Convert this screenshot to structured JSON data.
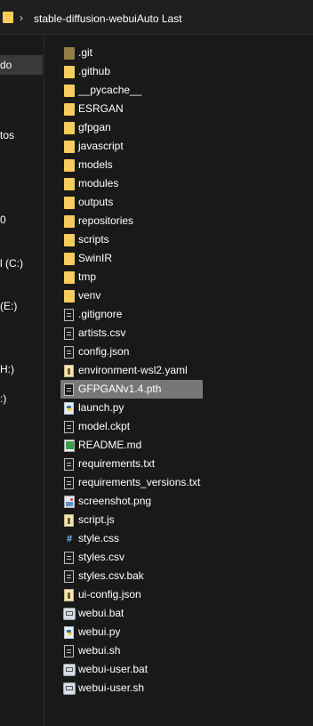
{
  "address_bar": {
    "separator": "›",
    "path": "stable-diffusion-webuiAuto Last"
  },
  "nav_pane": {
    "items": [
      {
        "label": "do",
        "selected": true
      },
      {
        "label": "tos",
        "selected": false
      },
      {
        "label": "0",
        "selected": false
      },
      {
        "label": "l (C:)",
        "selected": false
      },
      {
        "label": "(E:)",
        "selected": false
      },
      {
        "label": "H:)",
        "selected": false
      },
      {
        "label": ":)",
        "selected": false
      }
    ]
  },
  "files": [
    {
      "name": ".git",
      "icon": "folder-hidden-icon"
    },
    {
      "name": ".github",
      "icon": "folder-icon"
    },
    {
      "name": "__pycache__",
      "icon": "folder-icon"
    },
    {
      "name": "ESRGAN",
      "icon": "folder-icon"
    },
    {
      "name": "gfpgan",
      "icon": "folder-icon"
    },
    {
      "name": "javascript",
      "icon": "folder-icon"
    },
    {
      "name": "models",
      "icon": "folder-icon"
    },
    {
      "name": "modules",
      "icon": "folder-icon"
    },
    {
      "name": "outputs",
      "icon": "folder-icon"
    },
    {
      "name": "repositories",
      "icon": "folder-icon"
    },
    {
      "name": "scripts",
      "icon": "folder-icon"
    },
    {
      "name": "SwinIR",
      "icon": "folder-icon"
    },
    {
      "name": "tmp",
      "icon": "folder-icon"
    },
    {
      "name": "venv",
      "icon": "folder-icon"
    },
    {
      "name": ".gitignore",
      "icon": "text-file-icon"
    },
    {
      "name": "artists.csv",
      "icon": "text-file-icon"
    },
    {
      "name": "config.json",
      "icon": "text-file-icon"
    },
    {
      "name": "environment-wsl2.yaml",
      "icon": "script-file-icon"
    },
    {
      "name": "GFPGANv1.4.pth",
      "icon": "text-file-icon",
      "selected": true
    },
    {
      "name": "launch.py",
      "icon": "python-file-icon"
    },
    {
      "name": "model.ckpt",
      "icon": "text-file-icon"
    },
    {
      "name": "README.md",
      "icon": "markdown-file-icon"
    },
    {
      "name": "requirements.txt",
      "icon": "text-file-icon"
    },
    {
      "name": "requirements_versions.txt",
      "icon": "text-file-icon"
    },
    {
      "name": "screenshot.png",
      "icon": "image-file-icon"
    },
    {
      "name": "script.js",
      "icon": "script-file-icon"
    },
    {
      "name": "style.css",
      "icon": "css-file-icon"
    },
    {
      "name": "styles.csv",
      "icon": "text-file-icon"
    },
    {
      "name": "styles.csv.bak",
      "icon": "text-file-icon"
    },
    {
      "name": "ui-config.json",
      "icon": "script-file-icon"
    },
    {
      "name": "webui.bat",
      "icon": "batch-file-icon"
    },
    {
      "name": "webui.py",
      "icon": "python-file-icon"
    },
    {
      "name": "webui.sh",
      "icon": "text-file-icon"
    },
    {
      "name": "webui-user.bat",
      "icon": "batch-file-icon"
    },
    {
      "name": "webui-user.sh",
      "icon": "batch-file-icon"
    }
  ]
}
